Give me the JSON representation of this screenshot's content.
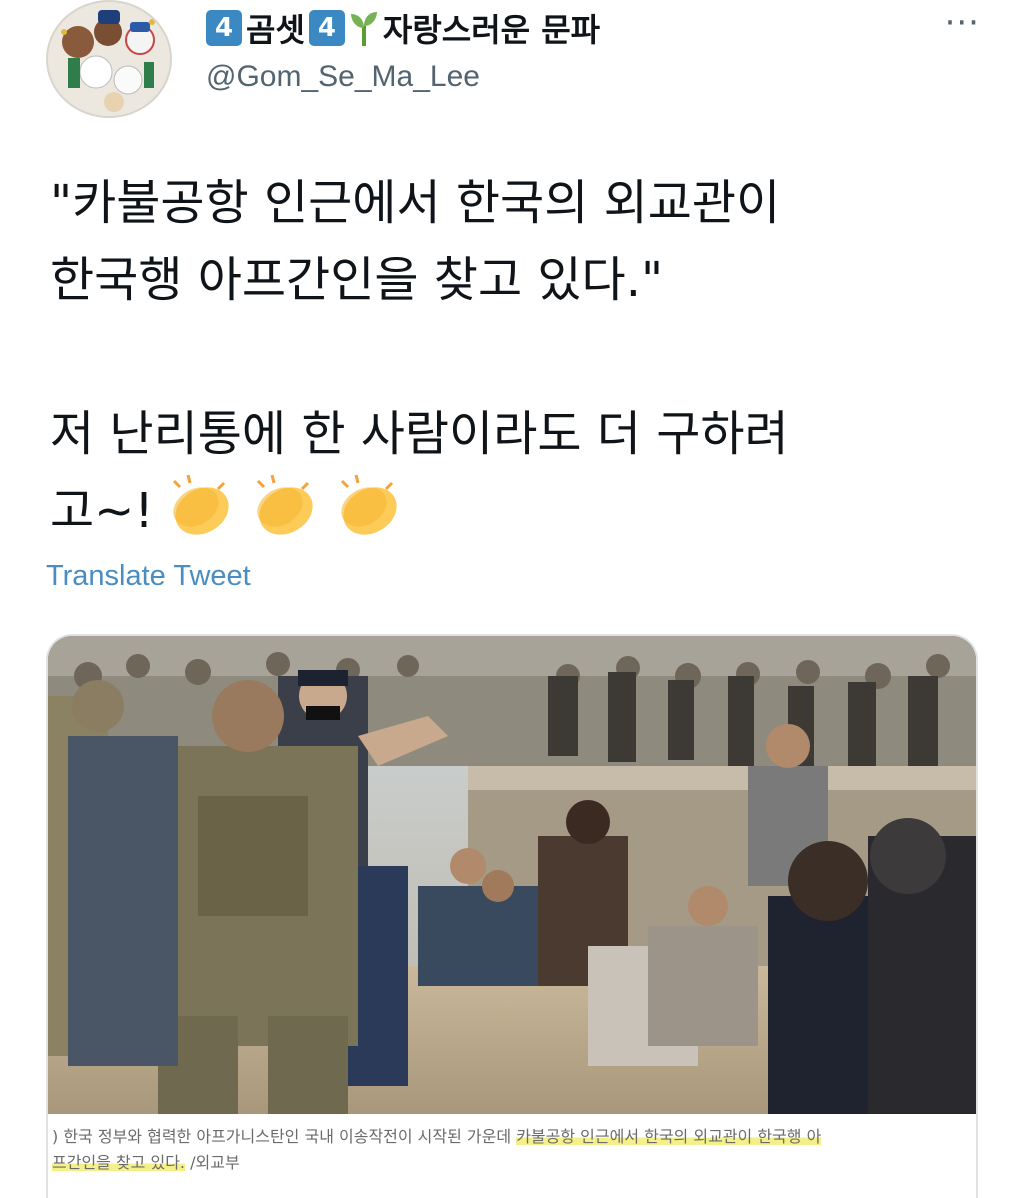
{
  "header": {
    "display_name_parts": {
      "badge_left": "4",
      "name": "곰셋",
      "badge_right": "4",
      "sprout": "🌱",
      "tagline": "자랑스러운 문파"
    },
    "handle": "@Gom_Se_Ma_Lee",
    "more_label": "···"
  },
  "tweet": {
    "line1": "\"카불공항 인근에서 한국의 외교관이",
    "line2": "한국행 아프간인을 찾고 있다.\"",
    "line3": "저 난리통에 한 사람이라도 더 구하려",
    "line4": "고~!",
    "emoji": "clapping-hands",
    "translate_label": "Translate Tweet"
  },
  "media": {
    "caption_line1_plain": ") 한국 정부와 협력한 아프가니스탄인 국내 이송작전이 시작된 가운데 ",
    "caption_line1_highlight": "카불공항 인근에서 한국의 외교관이 한국행 아",
    "caption_line2_highlight": "프간인을 찾고 있다.",
    "caption_line2_plain": " /외교부"
  },
  "colors": {
    "link": "#4a8dc2",
    "keycap": "#3b88c3",
    "highlight": "#f3f08a"
  }
}
